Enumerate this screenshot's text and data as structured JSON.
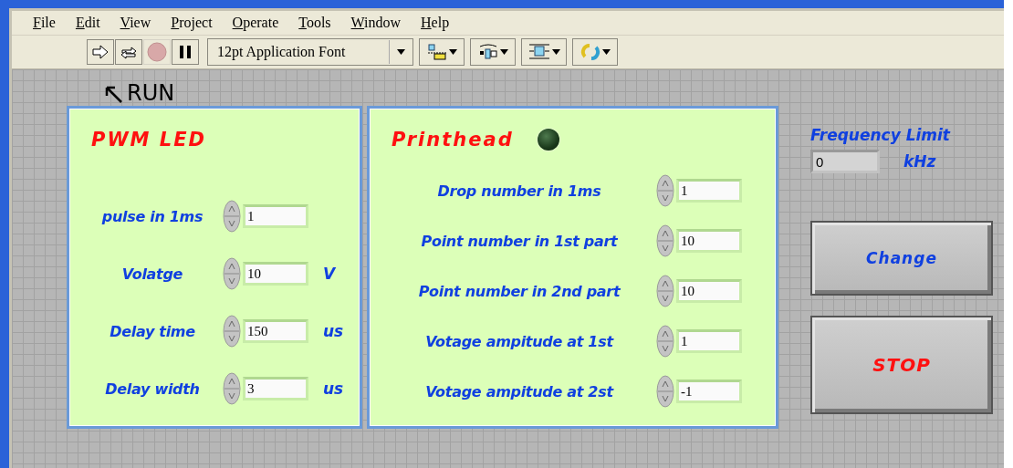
{
  "menu": [
    "File",
    "Edit",
    "View",
    "Project",
    "Operate",
    "Tools",
    "Window",
    "Help"
  ],
  "toolbar": {
    "buttons": [
      {
        "kind": "run",
        "disabled": false
      },
      {
        "kind": "run_continuous",
        "disabled": false
      },
      {
        "kind": "abort",
        "disabled": true
      },
      {
        "kind": "pause",
        "disabled": false
      }
    ],
    "font": "12pt Application Font",
    "tools": [
      {
        "kind": "align"
      },
      {
        "kind": "distribute"
      },
      {
        "kind": "resize"
      },
      {
        "kind": "reorder"
      }
    ]
  },
  "annotation": {
    "label": "RUN"
  },
  "pwm_panel": {
    "title": "PWM LED",
    "controls": [
      {
        "label": "pulse in 1ms",
        "value": "1"
      },
      {
        "label": "Volatge",
        "value": "10",
        "unit": "V"
      },
      {
        "label": "Delay time",
        "value": "150",
        "unit": "us"
      },
      {
        "label": "Delay width",
        "value": "3",
        "unit": "us"
      }
    ]
  },
  "printhead_panel": {
    "title": "Printhead",
    "led": {
      "on": false
    },
    "controls": [
      {
        "label": "Drop number in 1ms",
        "value": "1"
      },
      {
        "label": "Point number in 1st part",
        "value": "10"
      },
      {
        "label": "Point number in 2nd part",
        "value": "10"
      },
      {
        "label": "Votage ampitude at 1st",
        "value": "1"
      },
      {
        "label": "Votage ampitude at 2st",
        "value": "-1"
      }
    ]
  },
  "frequency_limit": {
    "label": "Frequency Limit",
    "value": "0",
    "unit": "kHz"
  },
  "buttons": [
    {
      "kind": "change",
      "label": "Change"
    },
    {
      "kind": "stop",
      "label": "STOP"
    }
  ]
}
